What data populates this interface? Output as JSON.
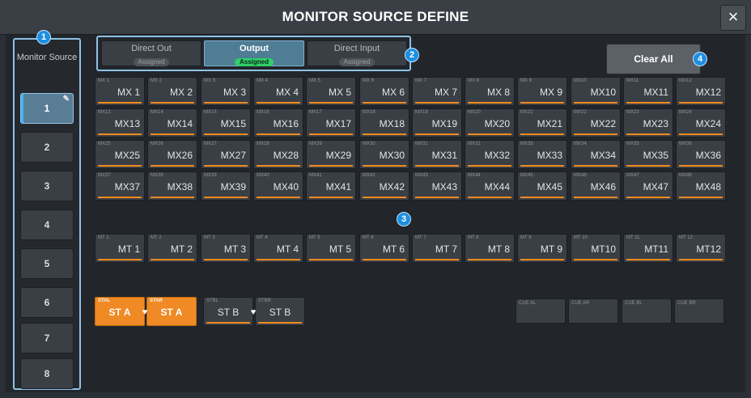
{
  "title": "MONITOR SOURCE DEFINE",
  "close_label": "×",
  "sidebar": {
    "header": "Monitor Source",
    "pencil": "✎",
    "items": [
      "1",
      "2",
      "3",
      "4",
      "5",
      "6",
      "7",
      "8"
    ],
    "selected": "1"
  },
  "tabs": [
    {
      "label": "Direct Out",
      "status": "Assigned"
    },
    {
      "label": "Output",
      "status": "Assigned",
      "active": true
    },
    {
      "label": "Direct Input",
      "status": "Assigned"
    }
  ],
  "clear_all": "Clear All",
  "badges": [
    "1",
    "2",
    "3",
    "4"
  ],
  "mix_channels": [
    {
      "small": "MX 1",
      "label": "MX 1"
    },
    {
      "small": "MX 2",
      "label": "MX 2"
    },
    {
      "small": "MX 3",
      "label": "MX 3"
    },
    {
      "small": "MX 4",
      "label": "MX 4"
    },
    {
      "small": "MX 5",
      "label": "MX 5"
    },
    {
      "small": "MX 6",
      "label": "MX 6"
    },
    {
      "small": "MX 7",
      "label": "MX 7"
    },
    {
      "small": "MX 8",
      "label": "MX 8"
    },
    {
      "small": "MX 9",
      "label": "MX 9"
    },
    {
      "small": "MX10",
      "label": "MX10"
    },
    {
      "small": "MX11",
      "label": "MX11"
    },
    {
      "small": "MX12",
      "label": "MX12"
    },
    {
      "small": "MX13",
      "label": "MX13"
    },
    {
      "small": "MX14",
      "label": "MX14"
    },
    {
      "small": "MX15",
      "label": "MX15"
    },
    {
      "small": "MX16",
      "label": "MX16"
    },
    {
      "small": "MX17",
      "label": "MX17"
    },
    {
      "small": "MX18",
      "label": "MX18"
    },
    {
      "small": "MX19",
      "label": "MX19"
    },
    {
      "small": "MX20",
      "label": "MX20"
    },
    {
      "small": "MX21",
      "label": "MX21"
    },
    {
      "small": "MX22",
      "label": "MX22"
    },
    {
      "small": "MX23",
      "label": "MX23"
    },
    {
      "small": "MX24",
      "label": "MX24"
    },
    {
      "small": "MX25",
      "label": "MX25"
    },
    {
      "small": "MX26",
      "label": "MX26"
    },
    {
      "small": "MX27",
      "label": "MX27"
    },
    {
      "small": "MX28",
      "label": "MX28"
    },
    {
      "small": "MX29",
      "label": "MX29"
    },
    {
      "small": "MX30",
      "label": "MX30"
    },
    {
      "small": "MX31",
      "label": "MX31"
    },
    {
      "small": "MX32",
      "label": "MX32"
    },
    {
      "small": "MX33",
      "label": "MX33"
    },
    {
      "small": "MX34",
      "label": "MX34"
    },
    {
      "small": "MX35",
      "label": "MX35"
    },
    {
      "small": "MX36",
      "label": "MX36"
    },
    {
      "small": "MX37",
      "label": "MX37"
    },
    {
      "small": "MX38",
      "label": "MX38"
    },
    {
      "small": "MX39",
      "label": "MX39"
    },
    {
      "small": "MX40",
      "label": "MX40"
    },
    {
      "small": "MX41",
      "label": "MX41"
    },
    {
      "small": "MX42",
      "label": "MX42"
    },
    {
      "small": "MX43",
      "label": "MX43"
    },
    {
      "small": "MX44",
      "label": "MX44"
    },
    {
      "small": "MX45",
      "label": "MX45"
    },
    {
      "small": "MX46",
      "label": "MX46"
    },
    {
      "small": "MX47",
      "label": "MX47"
    },
    {
      "small": "MX48",
      "label": "MX48"
    }
  ],
  "matrix_channels": [
    {
      "small": "MT 1",
      "label": "MT 1"
    },
    {
      "small": "MT 2",
      "label": "MT 2"
    },
    {
      "small": "MT 3",
      "label": "MT 3"
    },
    {
      "small": "MT 4",
      "label": "MT 4"
    },
    {
      "small": "MT 5",
      "label": "MT 5"
    },
    {
      "small": "MT 6",
      "label": "MT 6"
    },
    {
      "small": "MT 7",
      "label": "MT 7"
    },
    {
      "small": "MT 8",
      "label": "MT 8"
    },
    {
      "small": "MT 9",
      "label": "MT 9"
    },
    {
      "small": "MT 10",
      "label": "MT10"
    },
    {
      "small": "MT 11",
      "label": "MT11"
    },
    {
      "small": "MT 12",
      "label": "MT12"
    }
  ],
  "stereo_channels": [
    {
      "small": "STAL",
      "label": "ST A",
      "lit": true
    },
    {
      "small": "STAR",
      "label": "ST A",
      "lit": true
    },
    {
      "small": "STBL",
      "label": "ST B",
      "lit": false
    },
    {
      "small": "STBR",
      "label": "ST B",
      "lit": false
    }
  ],
  "link_icon": "♥",
  "cue_channels": [
    {
      "small": "CUE AL"
    },
    {
      "small": "CUE AR"
    },
    {
      "small": "CUE BL"
    },
    {
      "small": "CUE BR"
    }
  ],
  "colors": {
    "accent_blue": "#8fc2e6",
    "assigned_green": "#2fcf6a",
    "channel_orange": "#f28a1e",
    "badge_blue": "#1e8fe0"
  }
}
